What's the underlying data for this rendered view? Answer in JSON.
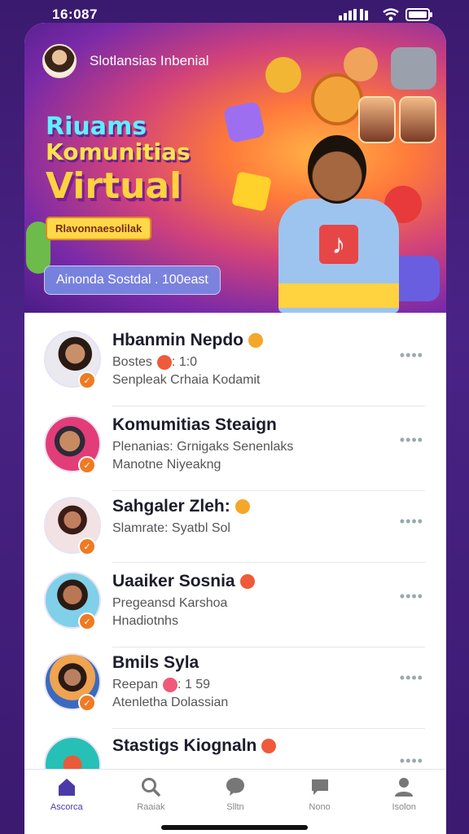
{
  "status_bar": {
    "time": "16:087"
  },
  "hero": {
    "header_title": "Slotlansias Inbenial",
    "title_line_1": "Riuams",
    "title_line_2": "Komunitias",
    "title_line_3": "Virtual",
    "ribbon": "Rlavonnaesolilak",
    "chip": "Ainonda Sostdal . 100east"
  },
  "list": {
    "items": [
      {
        "title": "Hbanmin Nepdo",
        "line1": "Bostes",
        "line1_tail": ": 1:0",
        "line2": "Senpleak Crhaia Kodamit",
        "emoji": "orange",
        "line1_emoji": "red"
      },
      {
        "title": "Komumitias Steaign",
        "line1": "Plenanias:",
        "line1_tail": " Grnigaks Senenlaks",
        "line2": "Manotne Niyeakng",
        "emoji": "",
        "line1_emoji": "none"
      },
      {
        "title": "Sahgaler Zleh:",
        "line1": "Slamrate: Syatbl Sol",
        "line1_tail": "",
        "line2": "",
        "emoji": "orange",
        "line1_emoji": "none"
      },
      {
        "title": "Uaaiker Sosnia",
        "line1": "Pregeansd Karshoa",
        "line1_tail": "",
        "line2": "Hnadiotnhs",
        "emoji": "red",
        "line1_emoji": "none"
      },
      {
        "title": "Bmils Syla",
        "line1": "Reepan",
        "line1_tail": ": 1 59",
        "line2": "Atenletha Dolassian",
        "emoji": "",
        "line1_emoji": "pink"
      },
      {
        "title": "Stastigs Kiognaln",
        "line1": "",
        "line1_tail": "",
        "line2": "",
        "emoji": "red",
        "line1_emoji": "none"
      }
    ]
  },
  "tabbar": {
    "tabs": [
      {
        "label": "Ascorca",
        "icon": "home-icon"
      },
      {
        "label": "Raaiak",
        "icon": "search-icon"
      },
      {
        "label": "Slltn",
        "icon": "chat-icon"
      },
      {
        "label": "Nono",
        "icon": "message-icon"
      },
      {
        "label": "Isolon",
        "icon": "profile-icon"
      }
    ]
  },
  "colors": {
    "accent": "#4a3aa8",
    "badge": "#ee7b22",
    "background": "#3a1a6e"
  }
}
